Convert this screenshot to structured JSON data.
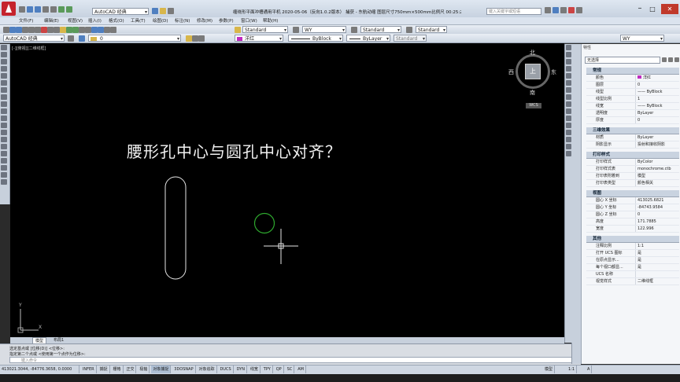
{
  "window": {
    "title": "缠绕形平面冲槽通用平机 2020-05-06（反向1.0.2版本）   捕获 - 东航动缩   图层尺寸750mm×500mm比例尺 00:25:29.dwg",
    "search_placeholder": "键入关键字或短语",
    "workspace": "AutoCAD 经典"
  },
  "menu": [
    "文件(F)",
    "编辑(E)",
    "视图(V)",
    "插入(I)",
    "格式(O)",
    "工具(T)",
    "绘图(D)",
    "标注(N)",
    "修改(M)",
    "参数(P)",
    "窗口(W)",
    "帮助(H)"
  ],
  "toolbar": {
    "workspace_combo": "AutoCAD 经典",
    "layer_value": "0",
    "text_style": "Standard",
    "dim_style": "WY",
    "table_style": "Standard",
    "mleader_style": "Standard",
    "color_value": "洋红",
    "linetype_value": "ByBlock",
    "lineweight_value": "ByLayer",
    "plot_style": "Standard",
    "wy_value": "WY"
  },
  "viewport": {
    "label": "[-][俯视][二维线框]",
    "question": "腰形孔中心与圆孔中心对齐？",
    "compass": {
      "n": "北",
      "s": "南",
      "e": "东",
      "w": "西",
      "center": "上"
    },
    "wcs": "WCS",
    "axis_x": "X",
    "axis_y": "Y"
  },
  "tabs": [
    "模型",
    "布局1"
  ],
  "command": {
    "line1": "选定基点或 [位移(D)] <位移>:",
    "line2": "指定第二个点或 <使用第一个点作为位移>:",
    "prompt": "键入命令"
  },
  "status": {
    "coords": "413021.3044, -84776.3658, 0.0000",
    "toggles": [
      "INFER",
      "捕捉",
      "栅格",
      "正交",
      "极轴",
      "对象捕捉",
      "3DOSNAP",
      "对象追踪",
      "DUCS",
      "DYN",
      "线宽",
      "TPY",
      "QP",
      "SC",
      "AM"
    ],
    "right": [
      "模型",
      "1:1",
      "A"
    ]
  },
  "properties": {
    "title": "特性",
    "selection": "无选择",
    "sections": [
      {
        "name": "常规",
        "rows": [
          [
            "颜色",
            "洋红"
          ],
          [
            "图层",
            "0"
          ],
          [
            "线型",
            "—— ByBlock"
          ],
          [
            "线型比例",
            "1"
          ],
          [
            "线宽",
            "—— ByBlock"
          ],
          [
            "透明度",
            "ByLayer"
          ],
          [
            "厚度",
            "0"
          ]
        ]
      },
      {
        "name": "三维效果",
        "rows": [
          [
            "材质",
            "ByLayer"
          ],
          [
            "阴影显示",
            "投射和接收阴影"
          ]
        ]
      },
      {
        "name": "打印样式",
        "rows": [
          [
            "打印样式",
            "ByColor"
          ],
          [
            "打印样式表",
            "monochrome.ctb"
          ],
          [
            "打印表附着到",
            "模型"
          ],
          [
            "打印表类型",
            "颜色相关"
          ]
        ]
      },
      {
        "name": "视图",
        "rows": [
          [
            "圆心 X 坐标",
            "413025.6821"
          ],
          [
            "圆心 Y 坐标",
            "-84743.9584"
          ],
          [
            "圆心 Z 坐标",
            "0"
          ],
          [
            "高度",
            "171.7885"
          ],
          [
            "宽度",
            "122.996"
          ]
        ]
      },
      {
        "name": "其他",
        "rows": [
          [
            "注释比例",
            "1:1"
          ],
          [
            "打开 UCS 图标",
            "是"
          ],
          [
            "在原点显示...",
            "是"
          ],
          [
            "每个视口都显...",
            "是"
          ],
          [
            "UCS 名称",
            ""
          ],
          [
            "视觉样式",
            "二维线框"
          ]
        ]
      }
    ]
  },
  "colors": {
    "canvas": "#000000",
    "drawing_line": "#e6e6e6",
    "circle": "#2ea82e",
    "magenta": "#c02bc0"
  }
}
